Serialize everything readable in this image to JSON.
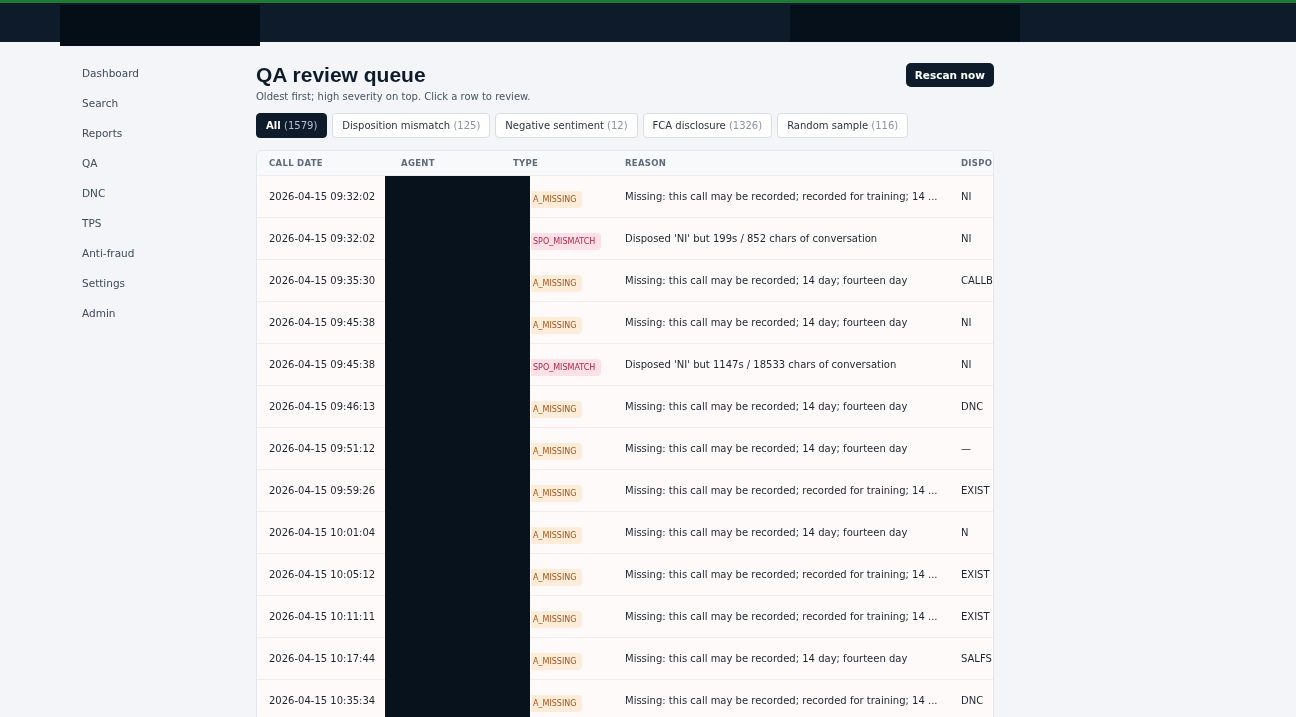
{
  "sidebar": {
    "items": [
      {
        "label": "Dashboard",
        "selected": false
      },
      {
        "label": "Search",
        "selected": false
      },
      {
        "label": "Reports",
        "selected": false
      },
      {
        "label": "QA",
        "selected": false
      },
      {
        "label": "DNC",
        "selected": false
      },
      {
        "label": "TPS",
        "selected": false
      },
      {
        "label": "Anti-fraud",
        "selected": false
      },
      {
        "label": "Settings",
        "selected": false
      },
      {
        "label": "Admin",
        "selected": false
      }
    ]
  },
  "page": {
    "title": "QA review queue",
    "subtitle": "Oldest first; high severity on top. Click a row to review.",
    "action": "Rescan now"
  },
  "filters": [
    {
      "label": "All",
      "count": "(1579)",
      "selected": true
    },
    {
      "label": "Disposition mismatch",
      "count": "(125)",
      "selected": false
    },
    {
      "label": "Negative sentiment",
      "count": "(12)",
      "selected": false
    },
    {
      "label": "FCA disclosure",
      "count": "(1326)",
      "selected": false
    },
    {
      "label": "Random sample",
      "count": "(116)",
      "selected": false
    }
  ],
  "table": {
    "columns": [
      "CALL DATE",
      "AGENT",
      "TYPE",
      "REASON",
      "DISPO"
    ],
    "rows": [
      {
        "call_date": "2026-04-15 09:32:02",
        "type": {
          "label": "A_MISSING",
          "kind": "missing"
        },
        "reason": "Missing: this call may be recorded; recorded for training; 14 ...",
        "dispo": "NI"
      },
      {
        "call_date": "2026-04-15 09:32:02",
        "type": {
          "label": "SPO_MISMATCH",
          "kind": "mismatch"
        },
        "reason": "Disposed 'NI' but 199s / 852 chars of conversation",
        "dispo": "NI"
      },
      {
        "call_date": "2026-04-15 09:35:30",
        "type": {
          "label": "A_MISSING",
          "kind": "missing"
        },
        "reason": "Missing: this call may be recorded; 14 day; fourteen day",
        "dispo": "CALLB"
      },
      {
        "call_date": "2026-04-15 09:45:38",
        "type": {
          "label": "A_MISSING",
          "kind": "missing"
        },
        "reason": "Missing: this call may be recorded; 14 day; fourteen day",
        "dispo": "NI"
      },
      {
        "call_date": "2026-04-15 09:45:38",
        "type": {
          "label": "SPO_MISMATCH",
          "kind": "mismatch"
        },
        "reason": "Disposed 'NI' but 1147s / 18533 chars of conversation",
        "dispo": "NI"
      },
      {
        "call_date": "2026-04-15 09:46:13",
        "type": {
          "label": "A_MISSING",
          "kind": "missing"
        },
        "reason": "Missing: this call may be recorded; 14 day; fourteen day",
        "dispo": "DNC"
      },
      {
        "call_date": "2026-04-15 09:51:12",
        "type": {
          "label": "A_MISSING",
          "kind": "missing"
        },
        "reason": "Missing: this call may be recorded; 14 day; fourteen day",
        "dispo": "—"
      },
      {
        "call_date": "2026-04-15 09:59:26",
        "type": {
          "label": "A_MISSING",
          "kind": "missing"
        },
        "reason": "Missing: this call may be recorded; recorded for training; 14 ...",
        "dispo": "EXIST"
      },
      {
        "call_date": "2026-04-15 10:01:04",
        "type": {
          "label": "A_MISSING",
          "kind": "missing"
        },
        "reason": "Missing: this call may be recorded; 14 day; fourteen day",
        "dispo": "N"
      },
      {
        "call_date": "2026-04-15 10:05:12",
        "type": {
          "label": "A_MISSING",
          "kind": "missing"
        },
        "reason": "Missing: this call may be recorded; recorded for training; 14 ...",
        "dispo": "EXIST"
      },
      {
        "call_date": "2026-04-15 10:11:11",
        "type": {
          "label": "A_MISSING",
          "kind": "missing"
        },
        "reason": "Missing: this call may be recorded; recorded for training; 14 ...",
        "dispo": "EXIST"
      },
      {
        "call_date": "2026-04-15 10:17:44",
        "type": {
          "label": "A_MISSING",
          "kind": "missing"
        },
        "reason": "Missing: this call may be recorded; 14 day; fourteen day",
        "dispo": "SALFS"
      },
      {
        "call_date": "2026-04-15 10:35:34",
        "type": {
          "label": "A_MISSING",
          "kind": "missing"
        },
        "reason": "Missing: this call may be recorded; recorded for training; 14 ...",
        "dispo": "DNC"
      }
    ]
  }
}
